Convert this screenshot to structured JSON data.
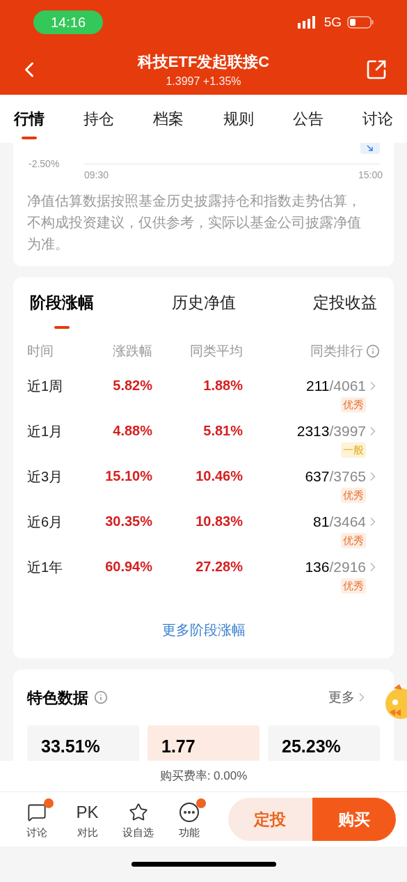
{
  "status_bar": {
    "time": "14:16",
    "network": "5G"
  },
  "header": {
    "title": "科技ETF发起联接C",
    "subtitle": "1.3997 +1.35%"
  },
  "tabs": [
    {
      "label": "行情",
      "selected": true
    },
    {
      "label": "持仓",
      "selected": false
    },
    {
      "label": "档案",
      "selected": false
    },
    {
      "label": "规则",
      "selected": false
    },
    {
      "label": "公告",
      "selected": false
    },
    {
      "label": "讨论",
      "selected": false
    }
  ],
  "estimate_chart": {
    "y_label": "-2.50%",
    "x_start": "09:30",
    "x_end": "15:00",
    "note": "净值估算数据按照基金历史披露持仓和指数走势估算，不构成投资建议，仅供参考，实际以基金公司披露净值为准。"
  },
  "performance": {
    "tabs": [
      {
        "label": "阶段涨幅",
        "selected": true
      },
      {
        "label": "历史净值",
        "selected": false
      },
      {
        "label": "定投收益",
        "selected": false
      }
    ],
    "columns": [
      "时间",
      "涨跌幅",
      "同类平均",
      "同类排行"
    ],
    "rows": [
      {
        "period": "近1周",
        "change": "5.82%",
        "average": "1.88%",
        "rank": "211",
        "total": "/4061",
        "rating": "优秀",
        "kind": "excellent"
      },
      {
        "period": "近1月",
        "change": "4.88%",
        "average": "5.81%",
        "rank": "2313",
        "total": "/3997",
        "rating": "一般",
        "kind": "average"
      },
      {
        "period": "近3月",
        "change": "15.10%",
        "average": "10.46%",
        "rank": "637",
        "total": "/3765",
        "rating": "优秀",
        "kind": "excellent"
      },
      {
        "period": "近6月",
        "change": "30.35%",
        "average": "10.83%",
        "rank": "81",
        "total": "/3464",
        "rating": "优秀",
        "kind": "excellent"
      },
      {
        "period": "近1年",
        "change": "60.94%",
        "average": "27.28%",
        "rank": "136",
        "total": "/2916",
        "rating": "优秀",
        "kind": "excellent"
      }
    ],
    "more_link": "更多阶段涨幅"
  },
  "features": {
    "title": "特色数据",
    "more": "更多",
    "cards": [
      {
        "value": "33.51%",
        "highlighted": false
      },
      {
        "value": "1.77",
        "highlighted": true
      },
      {
        "value": "25.23%",
        "highlighted": false
      }
    ]
  },
  "fee": "购买费率: 0.00%",
  "bottom_nav": [
    {
      "kind": "chat",
      "label": "讨论",
      "badge": true
    },
    {
      "kind": "pk",
      "icon_text": "PK",
      "label": "对比",
      "badge": false
    },
    {
      "kind": "star",
      "label": "设自选",
      "badge": false
    },
    {
      "kind": "more",
      "label": "功能",
      "badge": true
    }
  ],
  "actions": {
    "secondary": "定投",
    "primary": "购买"
  }
}
